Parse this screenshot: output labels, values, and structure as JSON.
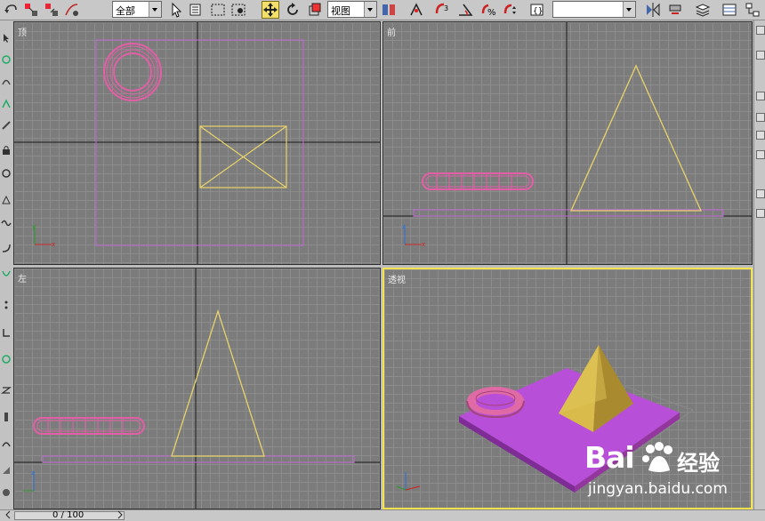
{
  "toolbar": {
    "selection_filter": "全部",
    "reference_coord": "视图",
    "named_selection": "",
    "tools": [
      "undo-icon",
      "select-link-icon",
      "unlink-icon",
      "bind-spacewarp-icon",
      "select-icon",
      "select-by-name-icon",
      "rect-region-icon",
      "window-crossing-icon",
      "move-icon",
      "rotate-icon",
      "scale-icon",
      "pivot-icon",
      "manipulate-icon",
      "snap-3d-icon",
      "angle-snap-icon",
      "percent-snap-icon",
      "spinner-snap-icon",
      "edit-named-sel-icon",
      "mirror-icon",
      "align-icon",
      "layer-manager-icon",
      "curve-editor-icon",
      "schematic-icon"
    ],
    "active_tool": "move-icon"
  },
  "viewports": {
    "top": {
      "label": "顶"
    },
    "front": {
      "label": "前"
    },
    "left": {
      "label": "左"
    },
    "perspective": {
      "label": "透视"
    }
  },
  "timeslider": {
    "frame_text": "0 / 100"
  },
  "colors": {
    "viewport_bg": "#7c7c7c",
    "grid": "#8c8c8c",
    "axis": "#1a1a1a",
    "torus_wire": "#e25fa6",
    "plane_wire": "#c066d6",
    "pyramid_wire": "#e8d36a",
    "active_border": "#f4e34c",
    "plane_fill": "#b84fd8",
    "pyramid_fill": "#c2a442"
  },
  "watermark": {
    "brand_left": "Bai",
    "brand_right": "经验",
    "url": "jingyan.baidu.com"
  }
}
